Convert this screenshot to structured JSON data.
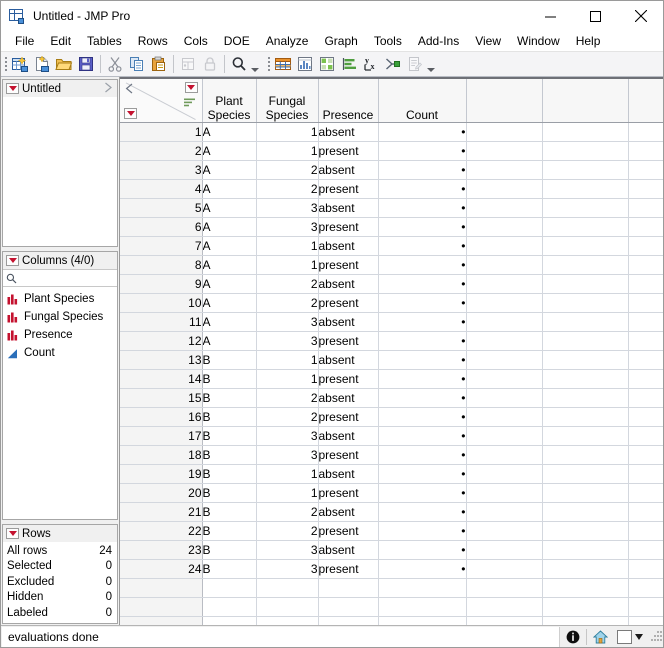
{
  "window": {
    "title": "Untitled - JMP Pro",
    "app_icon": "jmp-table-icon",
    "minimize": "minimize-icon",
    "maximize": "maximize-icon",
    "close": "close-icon"
  },
  "menubar": {
    "items": [
      {
        "label": "File"
      },
      {
        "label": "Edit"
      },
      {
        "label": "Tables"
      },
      {
        "label": "Rows"
      },
      {
        "label": "Cols"
      },
      {
        "label": "DOE"
      },
      {
        "label": "Analyze"
      },
      {
        "label": "Graph"
      },
      {
        "label": "Tools"
      },
      {
        "label": "Add-Ins"
      },
      {
        "label": "View"
      },
      {
        "label": "Window"
      },
      {
        "label": "Help"
      }
    ]
  },
  "toolbar": {
    "group1": [
      {
        "name": "new-data-table-icon"
      },
      {
        "name": "new-script-icon"
      },
      {
        "name": "open-file-icon"
      },
      {
        "name": "save-icon"
      },
      {
        "name": "cut-icon"
      },
      {
        "name": "copy-icon"
      },
      {
        "name": "paste-icon"
      },
      {
        "name": "unlock-rows-icon"
      },
      {
        "name": "lock-icon"
      },
      {
        "name": "search-icon"
      }
    ],
    "group2": [
      {
        "name": "data-table-icon"
      },
      {
        "name": "distribution-icon"
      },
      {
        "name": "tabulate-icon"
      },
      {
        "name": "bar-chart-icon"
      },
      {
        "name": "fit-y-by-x-icon"
      },
      {
        "name": "scatterplot-icon"
      },
      {
        "name": "script-editor-icon"
      }
    ]
  },
  "sidebar": {
    "untitled_panel": {
      "title": "Untitled",
      "menu_icon": "red-triangle-menu-icon",
      "expand_icon": "expand-arrow-icon"
    },
    "columns_panel": {
      "title": "Columns (4/0)",
      "menu_icon": "red-triangle-menu-icon",
      "search_placeholder": "",
      "search_value": "",
      "search_icon": "search-icon",
      "items": [
        {
          "label": "Plant Species",
          "type": "nominal"
        },
        {
          "label": "Fungal Species",
          "type": "nominal"
        },
        {
          "label": "Presence",
          "type": "nominal"
        },
        {
          "label": "Count",
          "type": "continuous"
        }
      ]
    },
    "rows_panel": {
      "title": "Rows",
      "menu_icon": "red-triangle-menu-icon",
      "stats": [
        {
          "label": "All rows",
          "value": "24"
        },
        {
          "label": "Selected",
          "value": "0"
        },
        {
          "label": "Excluded",
          "value": "0"
        },
        {
          "label": "Hidden",
          "value": "0"
        },
        {
          "label": "Labeled",
          "value": "0"
        }
      ]
    }
  },
  "table": {
    "corner": {
      "left_arrow_icon": "collapse-arrow-icon",
      "top_menu_icon": "red-triangle-menu-icon",
      "bottom_menu_icon": "red-triangle-menu-icon",
      "sort_icon": "sort-icon"
    },
    "columns": [
      {
        "label": "Plant\nSpecies",
        "line1": "Plant",
        "line2": "Species"
      },
      {
        "label": "Fungal\nSpecies",
        "line1": "Fungal",
        "line2": "Species"
      },
      {
        "label": "Presence",
        "line1": "",
        "line2": "Presence"
      },
      {
        "label": "Count",
        "line1": "",
        "line2": "Count"
      }
    ],
    "filler_columns": 3,
    "missing_value_glyph": "•",
    "rows": [
      {
        "n": "1",
        "plant": "A",
        "fungal": "1",
        "presence": "absent",
        "count": "•"
      },
      {
        "n": "2",
        "plant": "A",
        "fungal": "1",
        "presence": "present",
        "count": "•"
      },
      {
        "n": "3",
        "plant": "A",
        "fungal": "2",
        "presence": "absent",
        "count": "•"
      },
      {
        "n": "4",
        "plant": "A",
        "fungal": "2",
        "presence": "present",
        "count": "•"
      },
      {
        "n": "5",
        "plant": "A",
        "fungal": "3",
        "presence": "absent",
        "count": "•"
      },
      {
        "n": "6",
        "plant": "A",
        "fungal": "3",
        "presence": "present",
        "count": "•"
      },
      {
        "n": "7",
        "plant": "A",
        "fungal": "1",
        "presence": "absent",
        "count": "•"
      },
      {
        "n": "8",
        "plant": "A",
        "fungal": "1",
        "presence": "present",
        "count": "•"
      },
      {
        "n": "9",
        "plant": "A",
        "fungal": "2",
        "presence": "absent",
        "count": "•"
      },
      {
        "n": "10",
        "plant": "A",
        "fungal": "2",
        "presence": "present",
        "count": "•"
      },
      {
        "n": "11",
        "plant": "A",
        "fungal": "3",
        "presence": "absent",
        "count": "•"
      },
      {
        "n": "12",
        "plant": "A",
        "fungal": "3",
        "presence": "present",
        "count": "•"
      },
      {
        "n": "13",
        "plant": "B",
        "fungal": "1",
        "presence": "absent",
        "count": "•"
      },
      {
        "n": "14",
        "plant": "B",
        "fungal": "1",
        "presence": "present",
        "count": "•"
      },
      {
        "n": "15",
        "plant": "B",
        "fungal": "2",
        "presence": "absent",
        "count": "•"
      },
      {
        "n": "16",
        "plant": "B",
        "fungal": "2",
        "presence": "present",
        "count": "•"
      },
      {
        "n": "17",
        "plant": "B",
        "fungal": "3",
        "presence": "absent",
        "count": "•"
      },
      {
        "n": "18",
        "plant": "B",
        "fungal": "3",
        "presence": "present",
        "count": "•"
      },
      {
        "n": "19",
        "plant": "B",
        "fungal": "1",
        "presence": "absent",
        "count": "•"
      },
      {
        "n": "20",
        "plant": "B",
        "fungal": "1",
        "presence": "present",
        "count": "•"
      },
      {
        "n": "21",
        "plant": "B",
        "fungal": "2",
        "presence": "absent",
        "count": "•"
      },
      {
        "n": "22",
        "plant": "B",
        "fungal": "2",
        "presence": "present",
        "count": "•"
      },
      {
        "n": "23",
        "plant": "B",
        "fungal": "3",
        "presence": "absent",
        "count": "•"
      },
      {
        "n": "24",
        "plant": "B",
        "fungal": "3",
        "presence": "present",
        "count": "•"
      }
    ],
    "empty_rows": 3
  },
  "statusbar": {
    "message": "evaluations done",
    "info_icon": "info-icon",
    "home_icon": "home-icon",
    "color_swatch_icon": "color-swatch",
    "dropdown_icon": "chevron-down-icon",
    "resize_grip_icon": "resize-grip-icon"
  },
  "colors": {
    "nominal_icon": "#c4122f",
    "continuous_icon": "#2a6fba",
    "red_triangle": "#c4122f",
    "header_bg": "#f7f7f7",
    "rownum_bg": "#f4f4f4"
  }
}
